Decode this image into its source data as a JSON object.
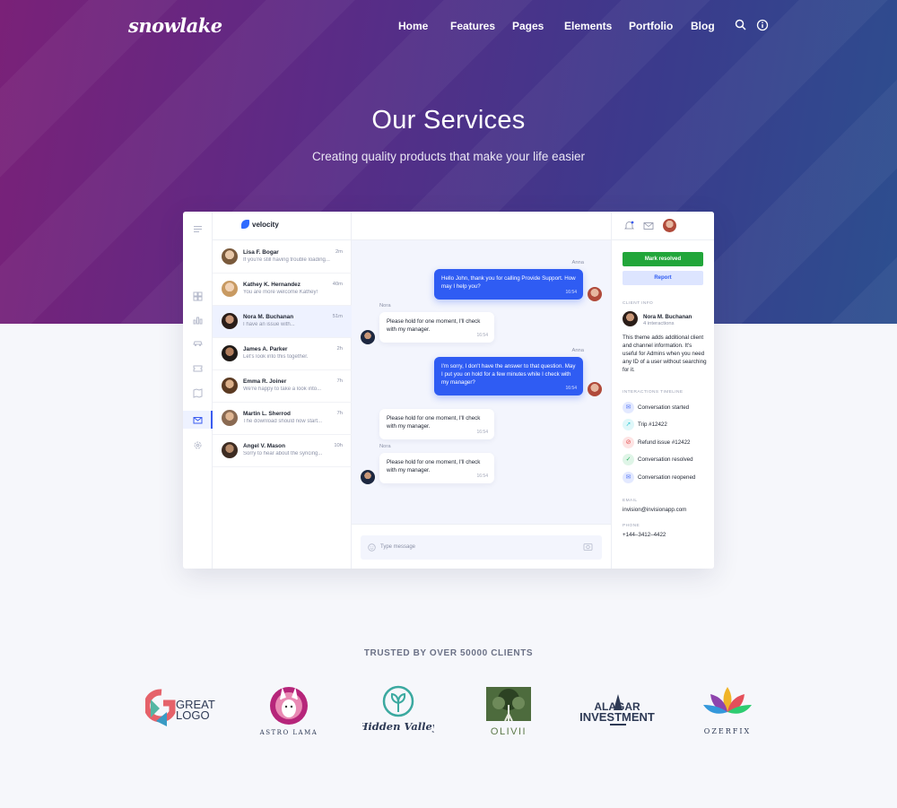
{
  "header": {
    "logo": "snowlake",
    "nav": [
      "Home",
      "Features",
      "Pages",
      "Elements",
      "Portfolio",
      "Blog"
    ],
    "icons": [
      "search-icon",
      "info-icon"
    ]
  },
  "hero": {
    "title": "Our Services",
    "subtitle": "Creating quality products that make your life easier"
  },
  "app": {
    "brand": "velocity",
    "conversations": [
      {
        "name": "Lisa F. Bogar",
        "preview": "If you're still having trouble loading...",
        "time": "2m"
      },
      {
        "name": "Kathey K. Hernandez",
        "preview": "You are more welcome Kathey!",
        "time": "40m"
      },
      {
        "name": "Nora M. Buchanan",
        "preview": "I have an issue with...",
        "time": "51m"
      },
      {
        "name": "James A. Parker",
        "preview": "Let's look into this together.",
        "time": "2h"
      },
      {
        "name": "Emma R. Joiner",
        "preview": "We're happy to take a look into...",
        "time": "7h"
      },
      {
        "name": "Martin L. Sherrod",
        "preview": "The download should now start...",
        "time": "7h"
      },
      {
        "name": "Angel V. Mason",
        "preview": "Sorry to hear about the syncing...",
        "time": "10h"
      }
    ],
    "messages": [
      {
        "author": "Anna",
        "text": "Hello John, thank you for calling Provide Support. How may I help you?",
        "time": "16:54"
      },
      {
        "author": "Nora",
        "text": "Please hold for one moment, I'll check with my manager.",
        "time": "16:54"
      },
      {
        "author": "Anna",
        "text": "I'm sorry, I don't have the answer to that question. May I put you on hold for a few minutes while I check with my manager?",
        "time": "16:54"
      },
      {
        "author": "",
        "text": "Please hold for one moment, I'll check with my manager.",
        "time": "16:54"
      },
      {
        "author": "Nora",
        "text": "Please hold for one moment, I'll check with my manager.",
        "time": "16:54"
      }
    ],
    "compose_placeholder": "Type message",
    "side": {
      "mark_resolved": "Mark resolved",
      "report": "Report",
      "client_info_label": "CLIENT INFO",
      "client_name": "Nora M. Buchanan",
      "client_interactions": "4 interactions",
      "client_note": "This theme adds additional client and channel information. It's useful for Admins when you need any ID of a user without searching for it.",
      "timeline_label": "INTERACTIONS TIMELINE",
      "timeline": [
        {
          "label": "Conversation started",
          "status": "mail",
          "color": "#5b7cf6"
        },
        {
          "label": "Trip #12422",
          "status": "trip",
          "color": "#33c7d4"
        },
        {
          "label": "Refund issue #12422",
          "status": "refund",
          "color": "#e34b4b"
        },
        {
          "label": "Conversation resolved",
          "status": "resolved",
          "color": "#27ae60"
        },
        {
          "label": "Conversation reopened",
          "status": "mail",
          "color": "#5b7cf6"
        }
      ],
      "email_label": "EMAIL",
      "email": "invision@invisionapp.com",
      "phone_label": "PHONE",
      "phone": "+144–3412–4422"
    }
  },
  "trusted": {
    "title": "TRUSTED BY OVER 50000 CLIENTS",
    "logos": [
      {
        "name": "great-logo",
        "text": "GREAT LOGO"
      },
      {
        "name": "astro-lama",
        "text": "ASTRO LAMA"
      },
      {
        "name": "hidden-valley",
        "text": "Hidden Valley"
      },
      {
        "name": "olivii",
        "text": "OLIVII"
      },
      {
        "name": "alagar-investment",
        "text": "ALAGAR INVESTMENT"
      },
      {
        "name": "ozerfix",
        "text": "OZERFIX"
      }
    ]
  },
  "colors": {
    "accent": "#2f5cf3",
    "success": "#22a63a",
    "hero_start": "#7a2178",
    "hero_end": "#2c4f8f"
  }
}
